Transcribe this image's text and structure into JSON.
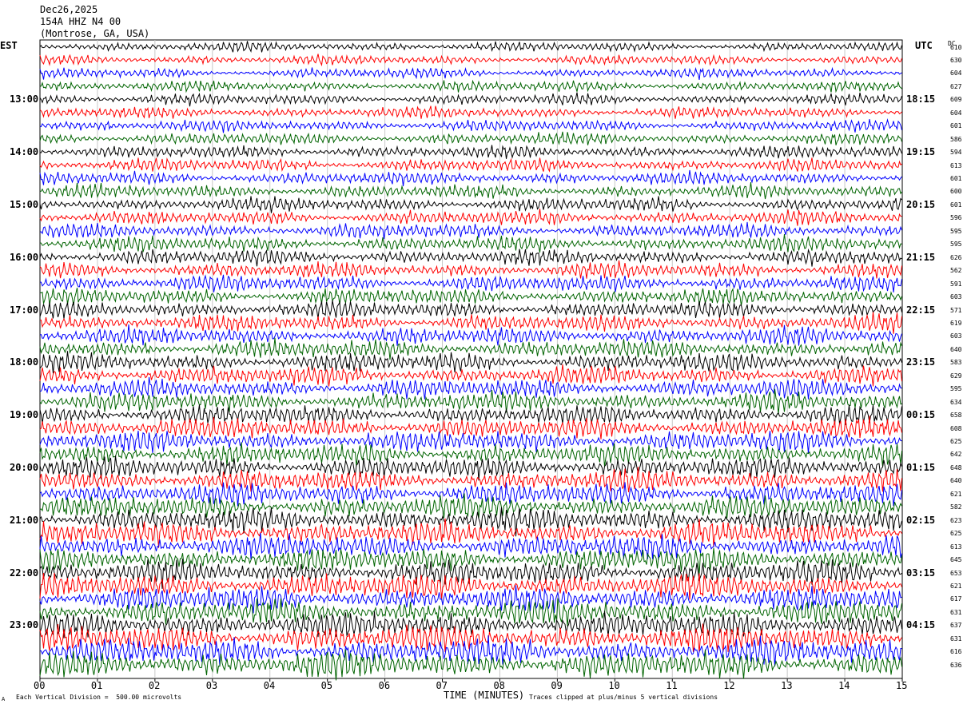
{
  "header": {
    "date": "Dec26,2025",
    "station": "154A HHZ N4 00",
    "location": "(Montrose, GA, USA)"
  },
  "left_tz": "EST",
  "right_tz": "UTC",
  "dc_label": "DC",
  "footer": {
    "scale_note": "Each Vertical Division =  500.00 microvolts",
    "clip_note": "Traces clipped at plus/minus 5 vertical divisions",
    "corner_mark": "A"
  },
  "chart_data": {
    "type": "line",
    "xlabel": "TIME (MINUTES)",
    "xlim": [
      0,
      15
    ],
    "x_ticks": [
      "00",
      "01",
      "02",
      "03",
      "04",
      "05",
      "06",
      "07",
      "08",
      "09",
      "10",
      "11",
      "12",
      "13",
      "14",
      "15"
    ],
    "trace_colors": [
      "#000000",
      "#ff0000",
      "#0000ff",
      "#006400"
    ],
    "left_hour_labels": [
      "13:00",
      "14:00",
      "15:00",
      "16:00",
      "17:00",
      "18:00",
      "19:00",
      "20:00",
      "21:00",
      "22:00",
      "23:00"
    ],
    "right_hour_labels": [
      "18:15",
      "19:15",
      "20:15",
      "21:15",
      "22:15",
      "23:15",
      "00:15",
      "01:15",
      "02:15",
      "03:15",
      "04:15"
    ],
    "dc_offsets": [
      "610",
      "630",
      "604",
      "627",
      "609",
      "604",
      "601",
      "586",
      "594",
      "613",
      "601",
      "600",
      "601",
      "596",
      "595",
      "595",
      "626",
      "562",
      "591",
      "603",
      "571",
      "619",
      "603",
      "640",
      "583",
      "629",
      "595",
      "634",
      "658",
      "608",
      "625",
      "642",
      "648",
      "640",
      "621",
      "582",
      "623",
      "625",
      "613",
      "645",
      "653",
      "621",
      "617",
      "631",
      "637",
      "631",
      "616",
      "636"
    ]
  }
}
